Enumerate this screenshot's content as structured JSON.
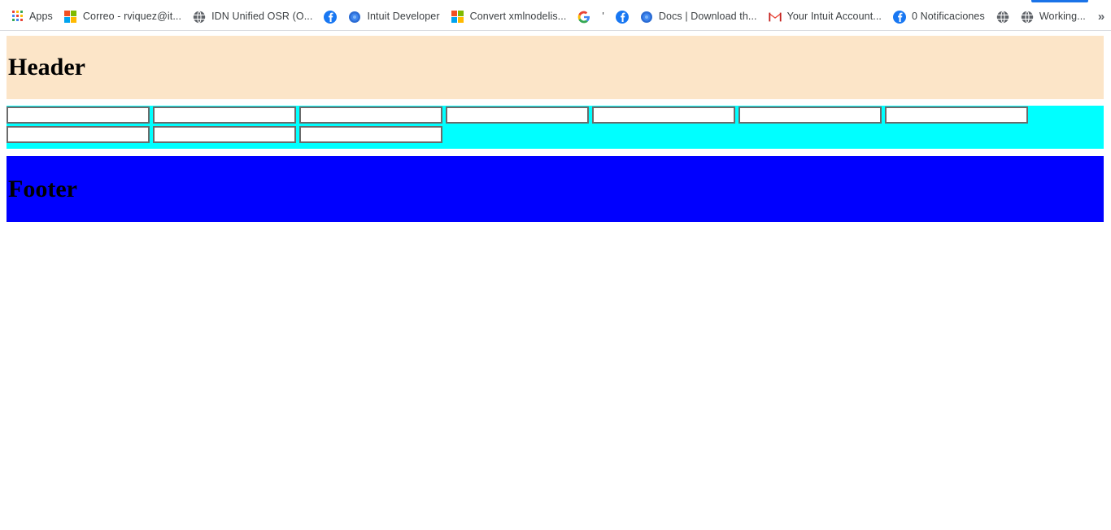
{
  "browser": {
    "tab_indicator_color": "#1a73e8",
    "overflow_label": "»",
    "bookmarks": [
      {
        "label": "Apps",
        "icon": "apps-grid-icon",
        "icon_type": "apps",
        "icon_only": false
      },
      {
        "label": "Correo - rviquez@it...",
        "icon": "microsoft-icon",
        "icon_type": "microsoft",
        "icon_only": false
      },
      {
        "label": "IDN Unified OSR (O...",
        "icon": "globe-icon",
        "icon_type": "globe",
        "icon_only": false
      },
      {
        "label": "",
        "icon": "facebook-icon",
        "icon_type": "facebook",
        "icon_only": true
      },
      {
        "label": "Intuit Developer",
        "icon": "blue-circle-icon",
        "icon_type": "bluecircle",
        "icon_only": false
      },
      {
        "label": "Convert xmlnodelis...",
        "icon": "microsoft-icon",
        "icon_type": "microsoft",
        "icon_only": false
      },
      {
        "label": "",
        "icon": "google-g-icon",
        "icon_type": "google",
        "icon_only": true
      },
      {
        "label": "'",
        "icon": "",
        "icon_type": "none",
        "icon_only": false
      },
      {
        "label": "",
        "icon": "facebook-icon",
        "icon_type": "facebook",
        "icon_only": true
      },
      {
        "label": "Docs | Download th...",
        "icon": "blue-circle-icon",
        "icon_type": "bluecircle",
        "icon_only": false
      },
      {
        "label": "Your Intuit Account...",
        "icon": "gmail-icon",
        "icon_type": "gmail",
        "icon_only": false
      },
      {
        "label": "0 Notificaciones",
        "icon": "facebook-icon",
        "icon_type": "facebook",
        "icon_only": false
      },
      {
        "label": "",
        "icon": "globe-icon",
        "icon_type": "globe",
        "icon_only": true
      },
      {
        "label": "Working...",
        "icon": "globe-icon",
        "icon_type": "globe",
        "icon_only": false
      }
    ]
  },
  "page": {
    "header": {
      "title": "Header",
      "background_color": "#fce5c8"
    },
    "form": {
      "background_color": "#00ffff",
      "rows": [
        {
          "fields": [
            {
              "name": "field-1",
              "value": "",
              "placeholder": ""
            },
            {
              "name": "field-2",
              "value": "",
              "placeholder": ""
            },
            {
              "name": "field-3",
              "value": "",
              "placeholder": ""
            },
            {
              "name": "field-4",
              "value": "",
              "placeholder": ""
            },
            {
              "name": "field-5",
              "value": "",
              "placeholder": ""
            },
            {
              "name": "field-6",
              "value": "",
              "placeholder": ""
            },
            {
              "name": "field-7",
              "value": "",
              "placeholder": ""
            }
          ]
        },
        {
          "fields": [
            {
              "name": "field-8",
              "value": "",
              "placeholder": ""
            },
            {
              "name": "field-9",
              "value": "",
              "placeholder": ""
            },
            {
              "name": "field-10",
              "value": "",
              "placeholder": ""
            }
          ]
        }
      ]
    },
    "footer": {
      "title": "Footer",
      "background_color": "#0000ff"
    }
  }
}
